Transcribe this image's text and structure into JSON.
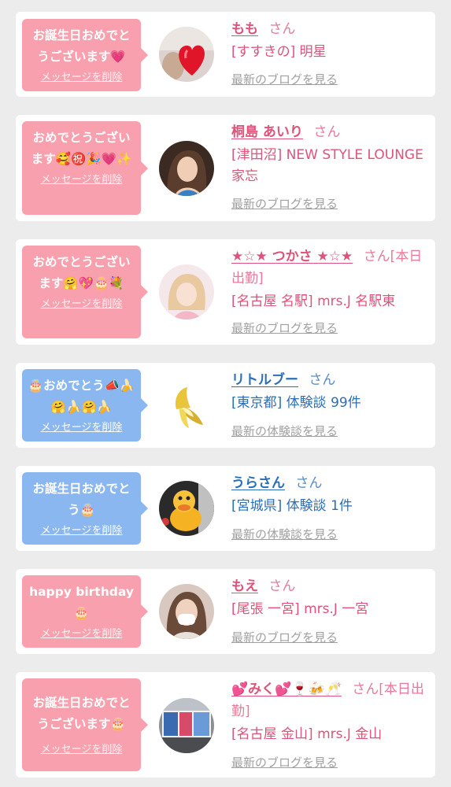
{
  "cards": [
    {
      "theme": "pink",
      "bubble_text": "お誕生日おめでとうございます💗",
      "delete_label": "メッセージを削除",
      "name": "もも",
      "honorific": "さん",
      "shop": "[すすきの] 明星",
      "latest_link": "最新のブログを見る",
      "avatar_icon": "heart-balloon-photo"
    },
    {
      "theme": "pink",
      "bubble_text": "おめでとうございます🥰㊗️🎉💗✨",
      "delete_label": "メッセージを削除",
      "name": "桐島 あいり",
      "honorific": "さん",
      "shop": "[津田沼] NEW STYLE LOUNGE 家忘",
      "latest_link": "最新のブログを見る",
      "avatar_icon": "woman-portrait-photo"
    },
    {
      "theme": "pink",
      "bubble_text": "おめでとうございます🤗💖🎂💐",
      "delete_label": "メッセージを削除",
      "name": "★☆★ つかさ ★☆★",
      "honorific": "さん[本日出勤]",
      "shop": "[名古屋 名駅] mrs.J 名駅東",
      "latest_link": "最新のブログを見る",
      "avatar_icon": "woman-portrait-photo"
    },
    {
      "theme": "blue",
      "bubble_text": "🎂おめでとう📣🍌🤗🍌🤗🍌",
      "delete_label": "メッセージを削除",
      "name": "リトルブー",
      "honorific": "さん",
      "shop": "[東京都] 体験談 99件",
      "latest_link": "最新の体験談を見る",
      "avatar_icon": "banana-photo"
    },
    {
      "theme": "blue",
      "bubble_text": "お誕生日おめでとう🎂",
      "delete_label": "メッセージを削除",
      "name": "うらさん",
      "honorific": "さん",
      "shop": "[宮城県] 体験談 1件",
      "latest_link": "最新の体験談を見る",
      "avatar_icon": "duck-toy-photo"
    },
    {
      "theme": "pink",
      "bubble_text": "happy birthday🎂",
      "delete_label": "メッセージを削除",
      "name": "もえ",
      "honorific": "さん",
      "shop": "[尾張 一宮] mrs.J 一宮",
      "latest_link": "最新のブログを見る",
      "avatar_icon": "masked-woman-photo"
    },
    {
      "theme": "pink",
      "bubble_text": "お誕生日おめでとうございます🎂",
      "delete_label": "メッセージを削除",
      "name": "💕みく💕🍷🍻🥂",
      "honorific": "さん[本日出勤]",
      "shop": "[名古屋 金山] mrs.J 金山",
      "latest_link": "最新のブログを見る",
      "avatar_icon": "billboard-photo"
    }
  ],
  "colors": {
    "pink_bubble": "#f8a0ad",
    "blue_bubble": "#8bb7f0",
    "name_pink": "#e0527a",
    "name_blue": "#2a6fb8",
    "link_gray": "#a0a0a0",
    "background": "#ececec"
  }
}
